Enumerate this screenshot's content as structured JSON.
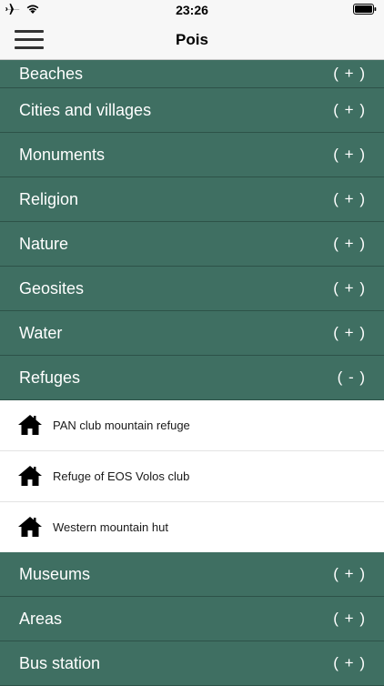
{
  "status_bar": {
    "time": "23:26"
  },
  "nav": {
    "title": "Pois"
  },
  "categories_top": [
    {
      "label": "Beaches",
      "toggle": "( + )"
    },
    {
      "label": "Cities and villages",
      "toggle": "( + )"
    },
    {
      "label": "Monuments",
      "toggle": "( + )"
    },
    {
      "label": "Religion",
      "toggle": "( + )"
    },
    {
      "label": "Nature",
      "toggle": "( + )"
    },
    {
      "label": "Geosites",
      "toggle": "( + )"
    },
    {
      "label": "Water",
      "toggle": "( + )"
    },
    {
      "label": "Refuges",
      "toggle": "( - )"
    }
  ],
  "refuges": [
    {
      "label": "PAN club mountain refuge",
      "icon": "house-icon"
    },
    {
      "label": "Refuge of EOS Volos club",
      "icon": "house-icon"
    },
    {
      "label": "Western mountain hut",
      "icon": "house-icon"
    }
  ],
  "categories_bottom": [
    {
      "label": "Museums",
      "toggle": "( + )"
    },
    {
      "label": "Areas",
      "toggle": "( + )"
    },
    {
      "label": "Bus station",
      "toggle": "( + )"
    }
  ],
  "colors": {
    "category_bg": "#3f6f62",
    "category_text": "#ffffff",
    "bar_bg": "#f7f7f7"
  }
}
